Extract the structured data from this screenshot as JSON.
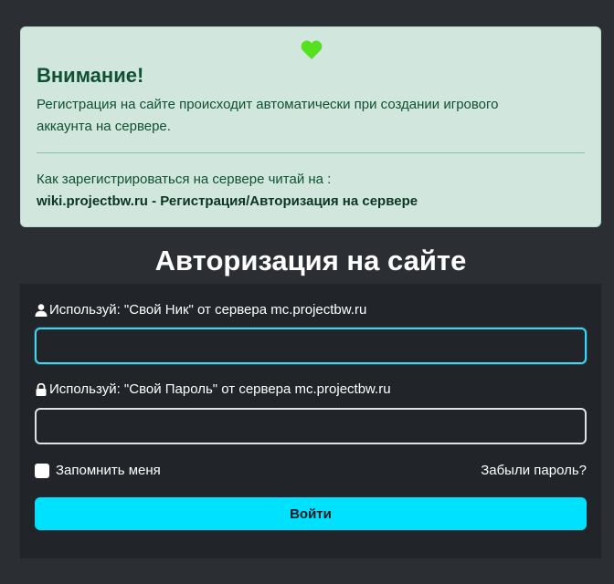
{
  "alert": {
    "icon": "heart-icon",
    "icon_color": "#55e11d",
    "title": "Внимание!",
    "text": "Регистрация на сайте происходит автоматически при создании игрового аккаунта на сервере.",
    "howto": "Как зарегистрироваться на сервере читай на :",
    "link_text": "wiki.projectbw.ru - Регистрация/Авторизация на сервере"
  },
  "login": {
    "heading": "Авторизация на сайте",
    "username_label": "Используй: \"Свой Ник\" от сервера mc.projectbw.ru",
    "username_value": "",
    "password_label": "Используй: \"Свой Пароль\" от сервера mc.projectbw.ru",
    "password_value": "",
    "remember_label": "Запомнить меня",
    "remember_checked": false,
    "forgot_label": "Забыли пароль?",
    "submit_label": "Войти",
    "accent_color": "#00e1ff"
  }
}
